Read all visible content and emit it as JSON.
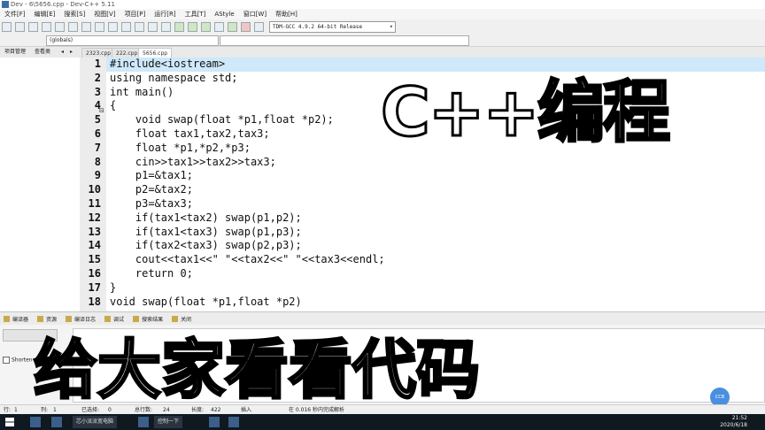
{
  "window": {
    "title": "Dev - 6\\5656.cpp - Dev-C++ 5.11"
  },
  "menu": [
    "文件[F]",
    "编辑[E]",
    "搜索[S]",
    "视图[V]",
    "项目[P]",
    "运行[R]",
    "工具[T]",
    "AStyle",
    "窗口[W]",
    "帮助[H]"
  ],
  "toolbar": {
    "compiler": "TDM-GCC 4.9.2 64-bit Release",
    "scope": "(globals)"
  },
  "left_tabs": [
    "项目管理",
    "查看类"
  ],
  "file_tabs": [
    "2323.cpp",
    "222.cpp",
    "5656.cpp"
  ],
  "active_tab": "5656.cpp",
  "editor": {
    "line_numbers": [
      "1",
      "2",
      "3",
      "4",
      "5",
      "6",
      "7",
      "8",
      "9",
      "10",
      "11",
      "12",
      "13",
      "14",
      "15",
      "16",
      "17",
      "18"
    ],
    "lines": [
      "#include<iostream>",
      "using namespace std;",
      "int main()",
      "{",
      "    void swap(float *p1,float *p2);",
      "    float tax1,tax2,tax3;",
      "    float *p1,*p2,*p3;",
      "    cin>>tax1>>tax2>>tax3;",
      "    p1=&tax1;",
      "    p2=&tax2;",
      "    p3=&tax3;",
      "    if(tax1<tax2) swap(p1,p2);",
      "    if(tax1<tax3) swap(p1,p3);",
      "    if(tax2<tax3) swap(p2,p3);",
      "    cout<<tax1<<\" \"<<tax2<<\" \"<<tax3<<endl;",
      "    return 0;",
      "}",
      "void swap(float *p1,float *p2)"
    ]
  },
  "bottom_tabs": [
    "编译器",
    "资源",
    "编译日志",
    "调试",
    "搜索结果",
    "关闭"
  ],
  "bottom_panel": {
    "checkbox_label": "Shorten"
  },
  "statusbar": {
    "line_label": "行:",
    "line": "1",
    "col_label": "列:",
    "col": "1",
    "sel_label": "已选择:",
    "sel": "0",
    "total_label": "总行数:",
    "total": "24",
    "len_label": "长度:",
    "len": "422",
    "mode": "插入",
    "parse": "在 0.016 秒内完成解析"
  },
  "taskbar": {
    "items": [
      "芯小派派宽电脑",
      "控制一下"
    ],
    "time": "21:52",
    "date": "2020/6/18"
  },
  "bubble_text": "CCB",
  "overlay": {
    "top": "C++编程",
    "bottom": "给大家看看代码"
  }
}
